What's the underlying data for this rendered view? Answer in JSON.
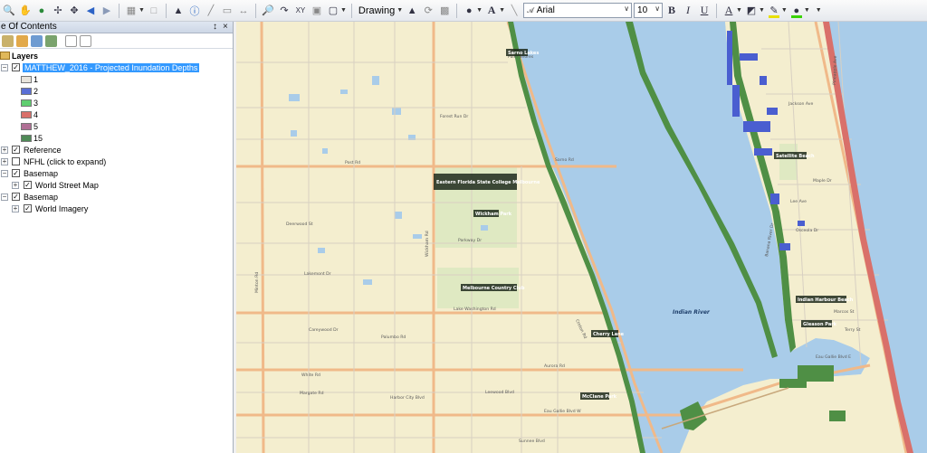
{
  "toolbar": {
    "drawing_label": "Drawing",
    "font_name": "Arial",
    "font_size": "10",
    "bold_label": "B",
    "italic_label": "I",
    "underline_label": "U",
    "font_color_label": "A",
    "font_glyph": "A"
  },
  "toc": {
    "title": "e Of Contents",
    "pin_glyph": "↕",
    "close_glyph": "×",
    "layers_label": "Layers",
    "items": [
      {
        "label": "MATTHEW_2016 - Projected Inundation Depths",
        "checked": true,
        "expanded": true,
        "selected": true
      },
      {
        "label": "Reference",
        "checked": true,
        "expanded": false
      },
      {
        "label": "NFHL (click to expand)",
        "checked": false,
        "expanded": false
      },
      {
        "label": "Basemap",
        "checked": true,
        "expanded": false
      },
      {
        "label": "World Street Map",
        "checked": true,
        "expanded": false
      },
      {
        "label": "Basemap",
        "checked": true,
        "expanded": false
      },
      {
        "label": "World Imagery",
        "checked": true,
        "expanded": false
      }
    ],
    "legend": [
      {
        "label": "1",
        "color": "#e8e4dc"
      },
      {
        "label": "2",
        "color": "#5a6fd6"
      },
      {
        "label": "3",
        "color": "#5fce6f"
      },
      {
        "label": "4",
        "color": "#d9706a"
      },
      {
        "label": "5",
        "color": "#b06f95"
      },
      {
        "label": "15",
        "color": "#4f8a57"
      }
    ]
  },
  "map": {
    "colors": {
      "land": "#f4eecf",
      "water": "#a9cce9",
      "major_road": "#f0b989",
      "minor_road": "#d8d0c2",
      "park": "#dfe9c2",
      "inundation_green": "#4f8f45",
      "inundation_blue": "#4a5ed0",
      "inundation_red": "#d9706a"
    },
    "street_labels": [
      "Palm Shores",
      "Sarno Rd",
      "Post Rd",
      "Parkway Dr",
      "Lake Washington Rd",
      "Aurora Rd",
      "Eau Gallie Blvd W",
      "Eau Gallie Blvd E",
      "Wickham Rd",
      "Minton Rd",
      "Croton Rd",
      "Forest Run Dr",
      "Lakemont Dr",
      "Deerwood St",
      "Careywood Dr",
      "White Rd",
      "Leewood Blvd",
      "Palumbo Rd",
      "Margate Rd",
      "Pineapple Ave",
      "Jackson Ave",
      "Lee Ave",
      "Maple Dr",
      "Osceola Dr",
      "Marcos St",
      "Terry St",
      "Banana River Dr",
      "Harbor City Blvd",
      "Sunnee Blvd"
    ],
    "poi_labels": [
      "Eastern Florida State College Melbourne",
      "Wickham Park",
      "Melbourne Country Club",
      "McClane Park",
      "Satellite Beach",
      "Indian Harbour Beach",
      "Gleason Park",
      "Cherry Lane",
      "Sarno Lakes"
    ],
    "water_label": "Indian River"
  }
}
